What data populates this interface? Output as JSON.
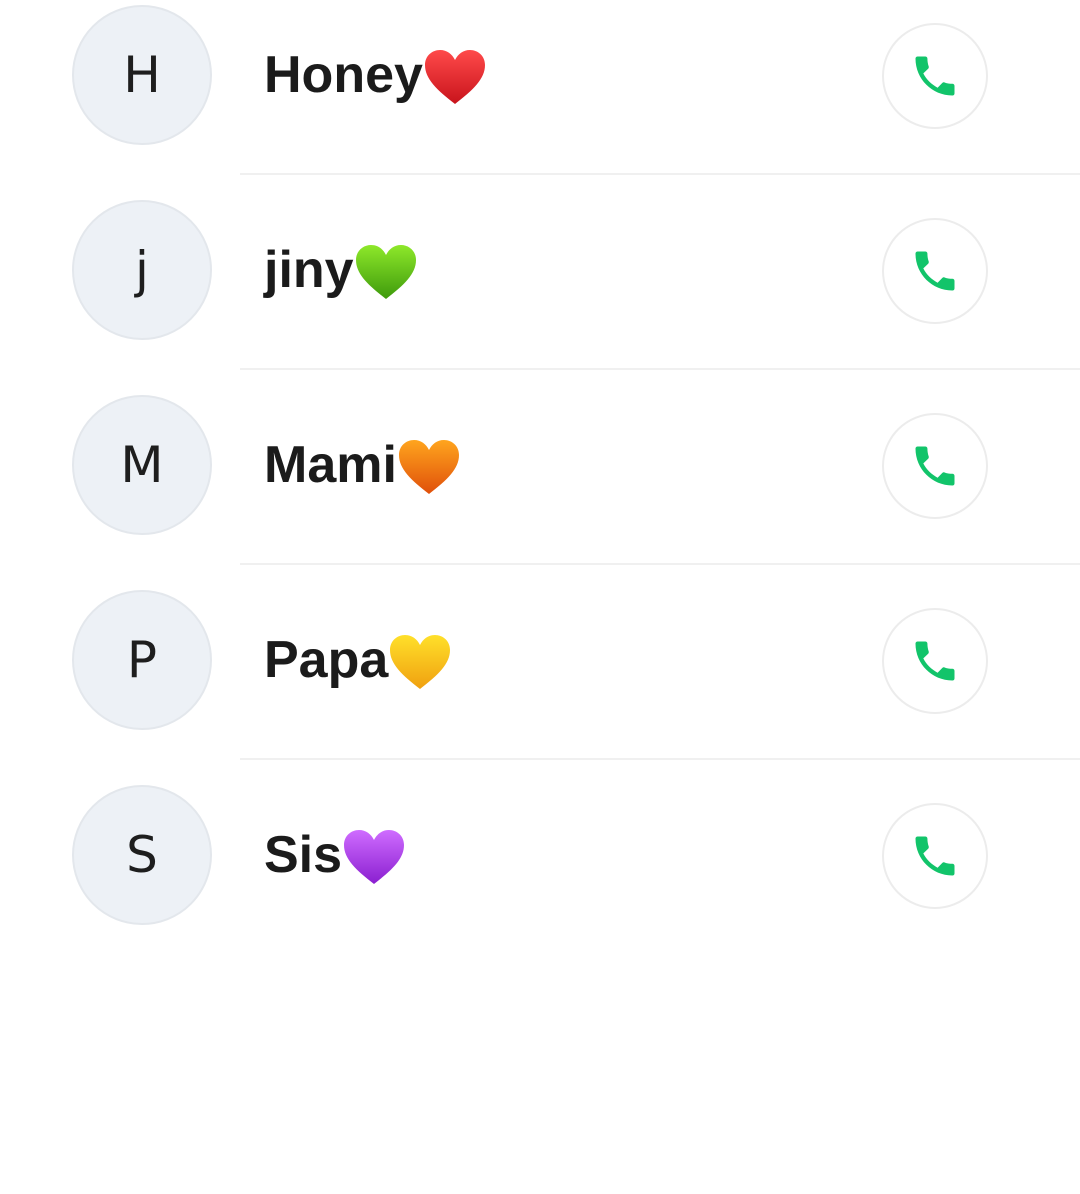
{
  "contacts": [
    {
      "initial": "H",
      "name": "Honey",
      "emoji_icon": "red-heart-icon",
      "heart_color": "#e8262d",
      "heart_dark": "#b8141c"
    },
    {
      "initial": "j",
      "name": "jiny",
      "emoji_icon": "green-heart-icon",
      "heart_color": "#6fd31a",
      "heart_dark": "#3e9a0c"
    },
    {
      "initial": "M",
      "name": "Mami",
      "emoji_icon": "orange-heart-icon",
      "heart_color": "#ff8a12",
      "heart_dark": "#d8560a"
    },
    {
      "initial": "P",
      "name": "Papa",
      "emoji_icon": "yellow-heart-icon",
      "heart_color": "#ffd21a",
      "heart_dark": "#e69a10"
    },
    {
      "initial": "S",
      "name": "Sis",
      "emoji_icon": "purple-heart-icon",
      "heart_color": "#b44cf0",
      "heart_dark": "#8a1fd0"
    }
  ],
  "call_icon_color": "#12c46a"
}
